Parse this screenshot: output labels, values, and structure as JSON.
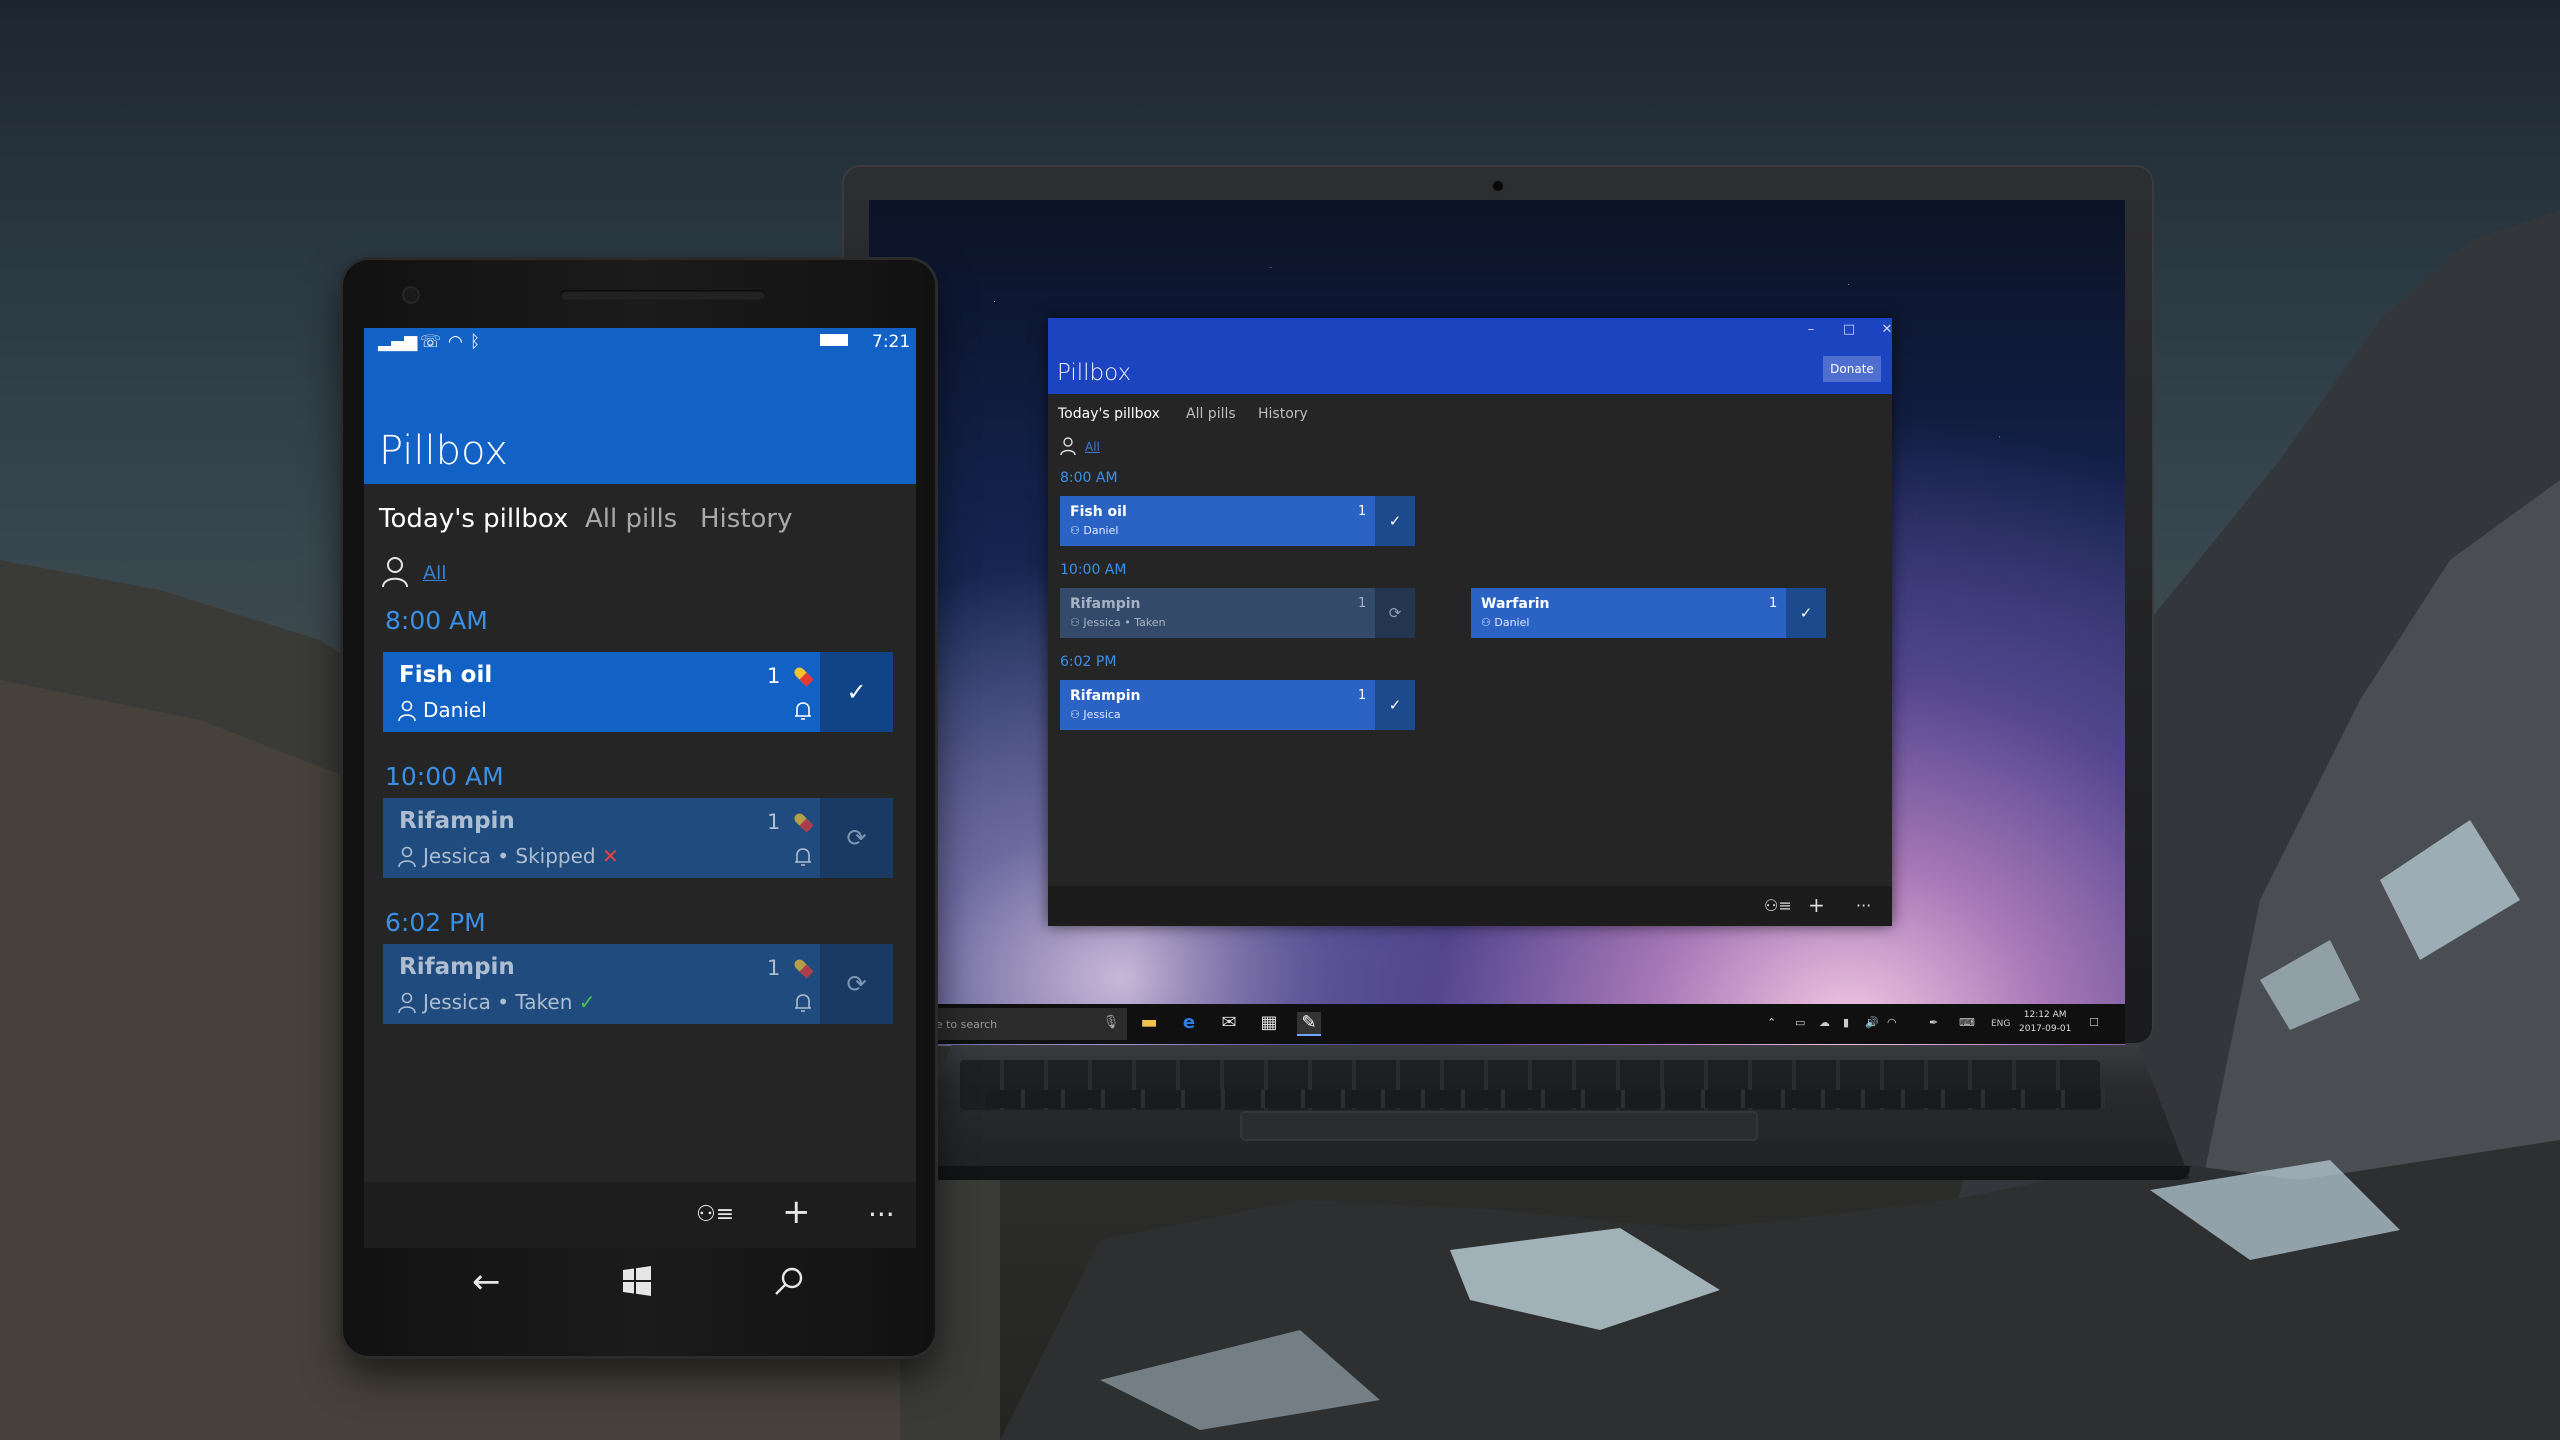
{
  "phone": {
    "status": {
      "icons": [
        "signal-icon",
        "wifi-calling-icon",
        "wifi-icon",
        "bluetooth-icon",
        "battery-icon"
      ],
      "time": "7:21"
    },
    "app_title": "Pillbox",
    "tabs": [
      {
        "label": "Today's pillbox",
        "active": true
      },
      {
        "label": "All pills",
        "active": false
      },
      {
        "label": "History",
        "active": false
      }
    ],
    "filter": {
      "label": "All"
    },
    "groups": [
      {
        "time": "8:00 AM",
        "items": [
          {
            "name": "Fish oil",
            "count": "1",
            "person": "Daniel",
            "status": "",
            "action_icon": "checkmark-icon"
          }
        ]
      },
      {
        "time": "10:00 AM",
        "items": [
          {
            "name": "Rifampin",
            "count": "1",
            "person": "Jessica",
            "separator": "•",
            "status": "Skipped",
            "status_mark": "✕",
            "action_icon": "refresh-icon"
          }
        ]
      },
      {
        "time": "6:02 PM",
        "items": [
          {
            "name": "Rifampin",
            "count": "1",
            "person": "Jessica",
            "separator": "•",
            "status": "Taken",
            "status_mark": "✓",
            "action_icon": "refresh-icon"
          }
        ]
      }
    ],
    "app_bar": [
      "people-filter-icon",
      "add-icon",
      "more-icon"
    ],
    "nav": [
      "back-icon",
      "windows-icon",
      "search-icon"
    ]
  },
  "laptop": {
    "window": {
      "title": "Pillbox",
      "donate_label": "Donate",
      "controls": [
        "minimize-icon",
        "maximize-icon",
        "close-icon"
      ],
      "tabs": [
        {
          "label": "Today's pillbox",
          "active": true
        },
        {
          "label": "All pills",
          "active": false
        },
        {
          "label": "History",
          "active": false
        }
      ],
      "filter": {
        "label": "All"
      },
      "groups": [
        {
          "time": "8:00 AM",
          "items": [
            {
              "name": "Fish oil",
              "count": "1",
              "person": "Daniel",
              "status": "",
              "action_icon": "checkmark-icon"
            }
          ]
        },
        {
          "time": "10:00 AM",
          "items": [
            {
              "name": "Rifampin",
              "count": "1",
              "person": "Jessica",
              "separator": "•",
              "status": "Taken",
              "action_icon": "refresh-icon"
            },
            {
              "name": "Warfarin",
              "count": "1",
              "person": "Daniel",
              "status": "",
              "action_icon": "checkmark-icon"
            }
          ]
        },
        {
          "time": "6:02 PM",
          "items": [
            {
              "name": "Rifampin",
              "count": "1",
              "person": "Jessica",
              "status": "",
              "action_icon": "checkmark-icon"
            }
          ]
        }
      ],
      "app_bar": [
        "people-filter-icon",
        "add-icon",
        "more-icon"
      ]
    },
    "taskbar": {
      "search_placeholder": "Type here to search",
      "apps": [
        "file-explorer-icon",
        "edge-icon",
        "mail-icon",
        "calendar-icon",
        "pillbox-icon"
      ],
      "tray": [
        "chevron-up-icon",
        "tablet-icon",
        "onedrive-icon",
        "battery-icon",
        "volume-icon",
        "network-icon",
        "pen-icon",
        "keyboard-icon"
      ],
      "language": "ENG",
      "clock_time": "12:12 AM",
      "clock_date": "2017-09-01"
    }
  },
  "colors": {
    "phone_accent": "#1261c4",
    "desktop_accent": "#1c44c0",
    "card_blue": "#2a63c4",
    "time_blue": "#3a90e8",
    "skip_red": "#e84040",
    "taken_green": "#46c846"
  }
}
